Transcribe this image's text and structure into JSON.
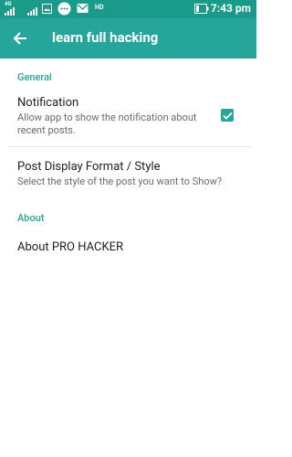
{
  "status_bar": {
    "network_label": "4G",
    "hd_label": "HD",
    "time": "7:43 pm"
  },
  "app_bar": {
    "title": "learn full hacking",
    "back_icon": "arrow-back-icon"
  },
  "sections": {
    "general": {
      "header": "General",
      "notification": {
        "title": "Notification",
        "summary": "Allow app to show the notification about recent posts.",
        "checked": true
      },
      "post_display": {
        "title": "Post Display Format / Style",
        "summary": "Select the style of the post you want to Show?"
      }
    },
    "about": {
      "header": "About",
      "about_item": {
        "title": "About PRO HACKER"
      }
    }
  },
  "colors": {
    "primary": "#26a69a",
    "primary_dark": "#1a9a88"
  }
}
